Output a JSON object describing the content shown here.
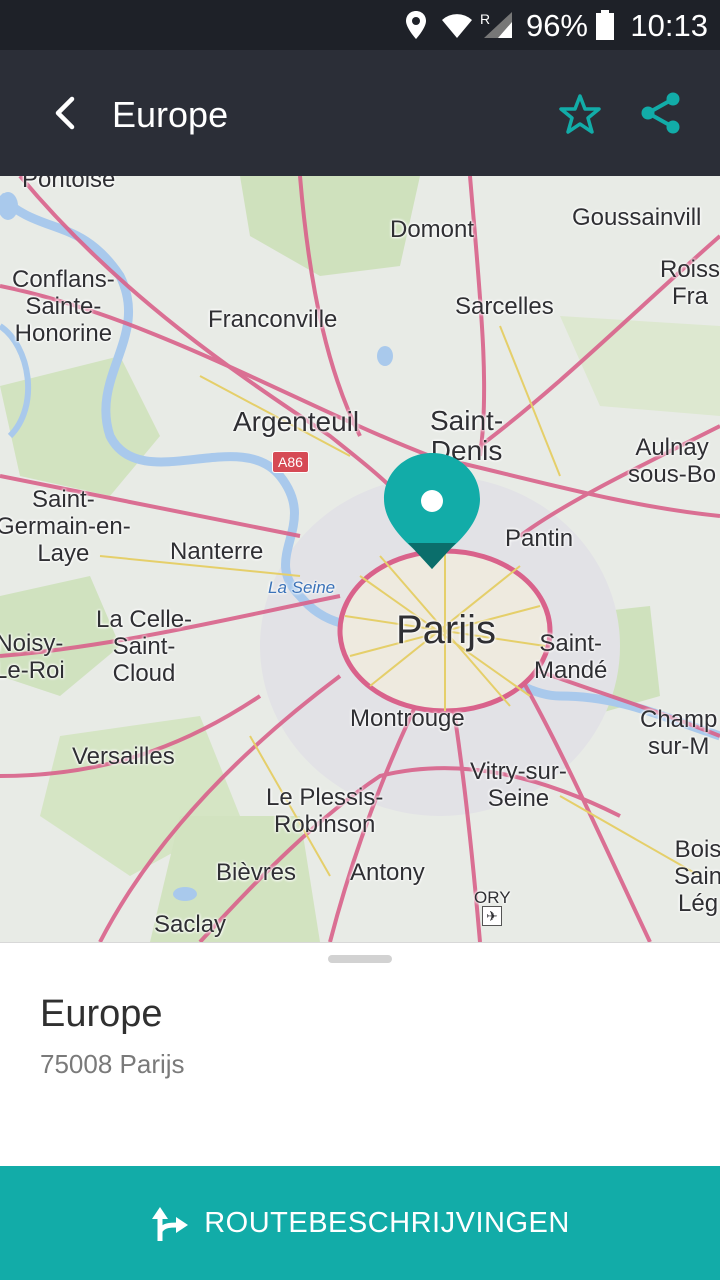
{
  "status_bar": {
    "battery": "96%",
    "time": "10:13",
    "icons": [
      "location-icon",
      "wifi-icon",
      "signal-icon",
      "battery-icon"
    ]
  },
  "app_bar": {
    "title": "Europe",
    "icons": [
      "back-arrow-icon",
      "star-icon",
      "share-icon"
    ]
  },
  "map": {
    "labels": {
      "pontoise": "Pontoise",
      "domont": "Domont",
      "goussainville": "Goussainvill",
      "roissy": "Roiss\nFra",
      "conflans": "Conflans-\nSainte-\nHonorine",
      "franconville": "Franconville",
      "sarcelles": "Sarcelles",
      "argenteuil": "Argenteuil",
      "saint_denis": "Saint-\nDenis",
      "aulnay": "Aulnay\nsous-Bo",
      "saint_germain": "Saint-\nGermain-en-\nLaye",
      "nanterre": "Nanterre",
      "pantin": "Pantin",
      "la_seine": "La Seine",
      "la_celle": "La Celle-\nSaint-\nCloud",
      "noisy": "Noisy-\nLe-Roi",
      "parijs": "Parijs",
      "saint_mande": "Saint-\nMandé",
      "montrouge": "Montrouge",
      "champigny": "Champ\nsur-M",
      "versailles": "Versailles",
      "vitry": "Vitry-sur-\nSeine",
      "le_plessis": "Le Plessis-\nRobinson",
      "boissy": "Bois\nSain\nLég",
      "bievres": "Bièvres",
      "antony": "Antony",
      "ory": "ORY",
      "saclay": "Saclay"
    },
    "road_shield": "A86",
    "accent": "#12aca8"
  },
  "sheet": {
    "name": "Europe",
    "address": "75008 Parijs"
  },
  "route_button": {
    "label": "ROUTEBESCHRIJVINGEN"
  },
  "colors": {
    "status_bar_bg": "#1e2128",
    "app_bar_bg": "#2b2e37",
    "accent": "#12aca8",
    "road_pink": "#d9628b",
    "road_yellow": "#e5cf6a"
  }
}
